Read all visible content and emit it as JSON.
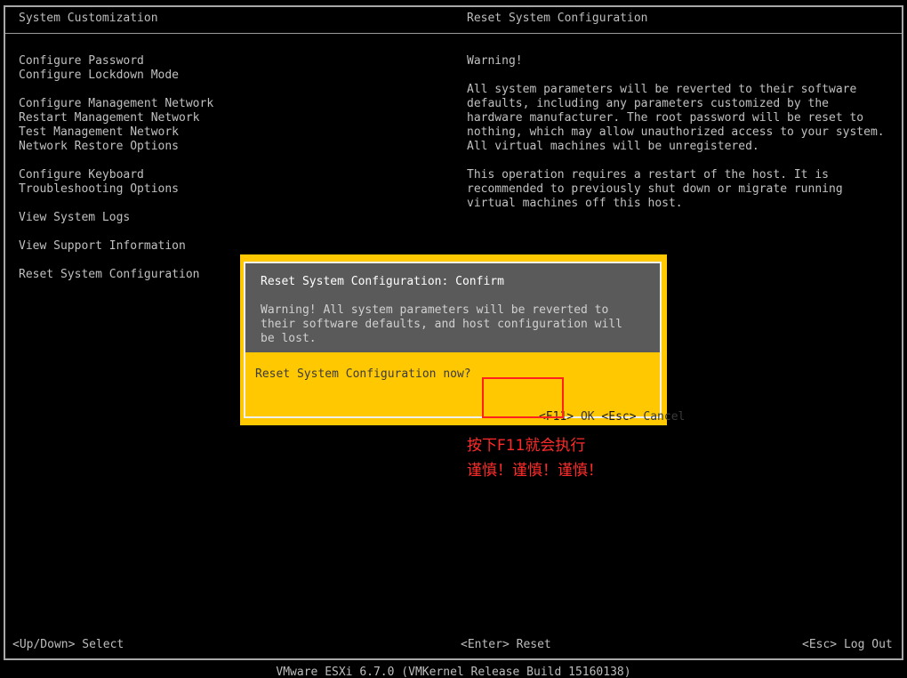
{
  "header": {
    "left_title": "System Customization",
    "right_title": "Reset System Configuration"
  },
  "menu": {
    "items": [
      {
        "label": "Configure Password",
        "gap": false
      },
      {
        "label": "Configure Lockdown Mode",
        "gap": false
      },
      {
        "label": "Configure Management Network",
        "gap": true
      },
      {
        "label": "Restart Management Network",
        "gap": false
      },
      {
        "label": "Test Management Network",
        "gap": false
      },
      {
        "label": "Network Restore Options",
        "gap": false
      },
      {
        "label": "Configure Keyboard",
        "gap": true
      },
      {
        "label": "Troubleshooting Options",
        "gap": false
      },
      {
        "label": "View System Logs",
        "gap": true
      },
      {
        "label": "View Support Information",
        "gap": true
      },
      {
        "label": "Reset System Configuration",
        "gap": true
      }
    ]
  },
  "info": {
    "warning_heading": "Warning!",
    "paragraph1": "All system parameters will be reverted to their software\ndefaults, including any parameters customized by the\nhardware manufacturer. The root password will be reset to\nnothing, which may allow unauthorized access to your system.\nAll virtual machines will be unregistered.",
    "paragraph2": "This operation requires a restart of the host. It is\nrecommended to previously shut down or migrate running\nvirtual machines off this host."
  },
  "dialog": {
    "title": "Reset System Configuration: Confirm",
    "warning": "Warning! All system parameters will be reverted to\ntheir software defaults, and host configuration will\nbe lost.",
    "question": "Reset System Configuration now?",
    "ok_key": "<F11>",
    "ok_label": "OK",
    "cancel_key": "<Esc>",
    "cancel_label": "Cancel"
  },
  "annotation": {
    "text": "按下F11就会执行\n谨慎！谨慎！谨慎！"
  },
  "footer": {
    "select_hint": "<Up/Down> Select",
    "enter_hint": "<Enter> Reset",
    "logout_hint": "<Esc> Log Out",
    "version": "VMware ESXi 6.7.0 (VMKernel Release Build 15160138)"
  },
  "colors": {
    "background": "#000000",
    "text": "#c0c0c0",
    "dialog_yellow": "#ffc800",
    "dialog_gray": "#5a5a5a",
    "annotation_red": "#ff2a2a"
  }
}
